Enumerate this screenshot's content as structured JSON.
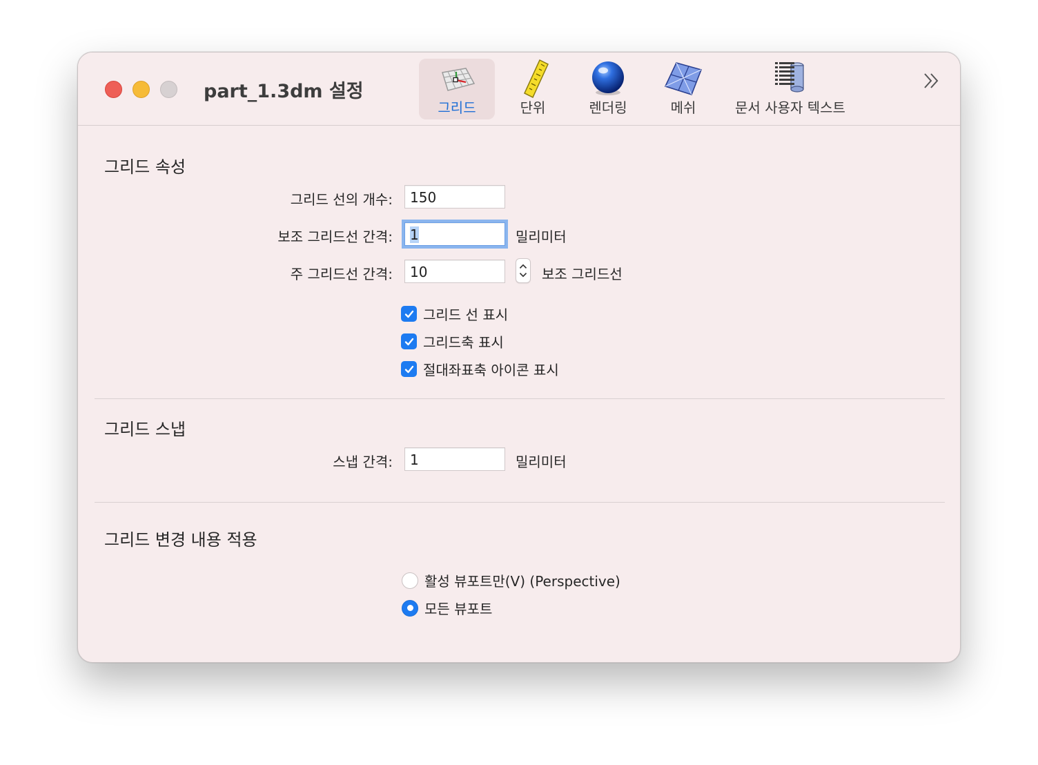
{
  "window": {
    "title": "part_1.3dm 설정"
  },
  "toolbar": {
    "items": [
      {
        "label": "그리드",
        "icon": "grid-icon",
        "selected": true
      },
      {
        "label": "단위",
        "icon": "ruler-icon",
        "selected": false
      },
      {
        "label": "렌더링",
        "icon": "sphere-icon",
        "selected": false
      },
      {
        "label": "메쉬",
        "icon": "mesh-icon",
        "selected": false
      },
      {
        "label": "문서 사용자 텍스트",
        "icon": "document-text-icon",
        "selected": false
      }
    ],
    "overflow_icon": "chevron-double-right-icon"
  },
  "grid_properties": {
    "title": "그리드 속성",
    "line_count": {
      "label": "그리드 선의 개수:",
      "value": "150"
    },
    "minor_spacing": {
      "label": "보조 그리드선 간격:",
      "value": "1",
      "unit": "밀리미터"
    },
    "major_spacing": {
      "label": "주 그리드선 간격:",
      "value": "10",
      "unit": "보조 그리드선"
    },
    "checkboxes": [
      {
        "label": "그리드 선 표시",
        "checked": true
      },
      {
        "label": "그리드축 표시",
        "checked": true
      },
      {
        "label": "절대좌표축 아이콘 표시",
        "checked": true
      }
    ]
  },
  "grid_snap": {
    "title": "그리드 스냅",
    "snap_spacing": {
      "label": "스냅 간격:",
      "value": "1",
      "unit": "밀리미터"
    }
  },
  "apply_changes": {
    "title": "그리드 변경 내용 적용",
    "options": [
      {
        "label": "활성 뷰포트만(V) (Perspective)",
        "selected": false
      },
      {
        "label": "모든 뷰포트",
        "selected": true
      }
    ]
  },
  "colors": {
    "window_bg": "#f7eced",
    "accent": "#1d7bf1",
    "focus_ring": "#8ab5ee",
    "close": "#ee5f57",
    "minimize": "#f6bb38",
    "zoom_inactive": "#d7d1d2"
  }
}
